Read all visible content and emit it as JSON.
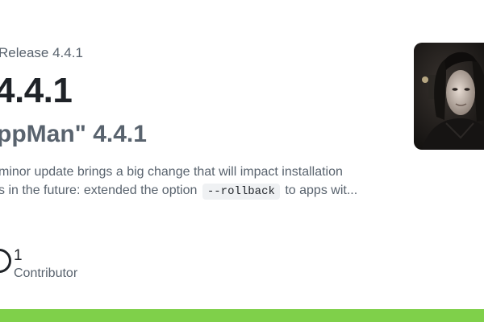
{
  "breadcrumb": {
    "text": "Release 4.4.1"
  },
  "release": {
    "version": "4.4.1",
    "name": "ppMan\" 4.4.1",
    "description": {
      "line1": "minor update brings a big change that will impact installation",
      "line2_before": "s in the future: extended the option",
      "code": "--rollback",
      "line2_after": "to apps wit..."
    }
  },
  "contributors": {
    "count": "1",
    "label": "Contributor"
  },
  "colors": {
    "accent_bar": "#7fd04a",
    "text_primary": "#1f2328",
    "text_muted": "#59636e"
  },
  "icons": {
    "contributors": "contributor-ring-icon",
    "avatar": "author-avatar"
  }
}
